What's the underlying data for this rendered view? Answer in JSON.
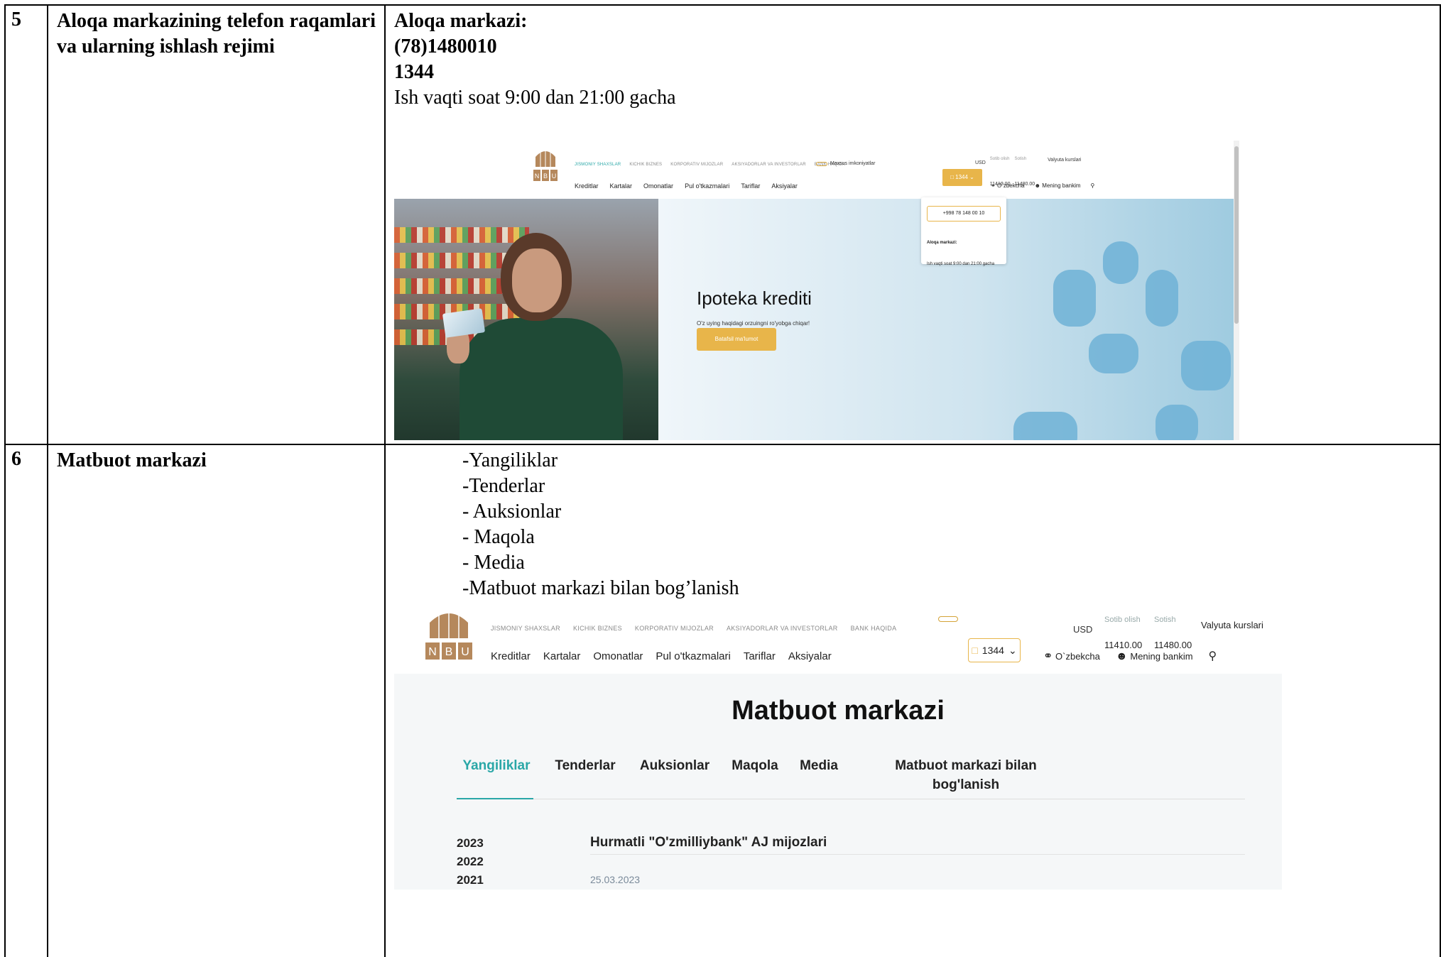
{
  "rows": [
    {
      "number": "5",
      "title": "Aloqa markazining telefon raqamlari va ularning ishlash rejimi",
      "content": {
        "line1": "Aloqa markazi:",
        "line2": "(78)1480010",
        "line3": "1344",
        "line4": "Ish vaqti soat 9:00 dan 21:00 gacha"
      }
    },
    {
      "number": "6",
      "title": "Matbuot markazi",
      "list": [
        "-Yangiliklar",
        "-Tenderlar",
        "- Auksionlar",
        "- Maqola",
        "- Media",
        "-Matbuot markazi bilan bog’lanish"
      ]
    }
  ],
  "screenshot1": {
    "logo_letters": [
      "N",
      "B",
      "U"
    ],
    "top_menu": [
      "JISMONIY SHAXSLAR",
      "KICHIK BIZNES",
      "KORPORATIV MIJOZLAR",
      "AKSIYADORLAR VA INVESTORLAR",
      "BANK HAQIDA"
    ],
    "accessibility": "Maxsus imkoniyatlar",
    "currency": "USD",
    "buy_label": "Sotib olish",
    "buy_value": "11410.00",
    "sell_label": "Sotish",
    "sell_value": "11480.00",
    "rates_link": "Valyuta kurslari",
    "nav": [
      "Kreditlar",
      "Kartalar",
      "Omonatlar",
      "Pul o'tkazmalari",
      "Tariflar",
      "Aksiyalar"
    ],
    "phone_button": "1344",
    "language": "O`zbekcha",
    "my_bank": "Mening bankim",
    "dropdown_phone": "+998 78 148 00 10",
    "dropdown_title": "Aloqa markazi:",
    "dropdown_hours": "Ish vaqti soat 9:00 dan 21:00 gacha",
    "banner_title": "Ipoteka krediti",
    "banner_subtitle": "O'z uying haqidagi orzuingni ro'yobga chiqar!",
    "banner_button": "Batafsil ma'lumot",
    "colors": {
      "accent": "#e8b54a",
      "teal": "#2aa7a7",
      "banner": "#9fcbe0"
    }
  },
  "screenshot2": {
    "logo_letters": [
      "N",
      "B",
      "U"
    ],
    "top_menu": [
      "JISMONIY SHAXSLAR",
      "KICHIK BIZNES",
      "KORPORATIV MIJOZLAR",
      "AKSIYADORLAR VA INVESTORLAR",
      "BANK HAQIDA"
    ],
    "currency": "USD",
    "buy_label": "Sotib olish",
    "buy_value": "11410.00",
    "sell_label": "Sotish",
    "sell_value": "11480.00",
    "rates_link": "Valyuta kurslari",
    "nav": [
      "Kreditlar",
      "Kartalar",
      "Omonatlar",
      "Pul o'tkazmalari",
      "Tariflar",
      "Aksiyalar"
    ],
    "phone_button": "1344",
    "language": "O`zbekcha",
    "my_bank": "Mening bankim",
    "page_title": "Matbuot markazi",
    "tabs": [
      "Yangiliklar",
      "Tenderlar",
      "Auksionlar",
      "Maqola",
      "Media",
      "Matbuot markazi bilan bog'lanish"
    ],
    "years": [
      "2023",
      "2022",
      "2021"
    ],
    "news_title": "Hurmatli \"O'zmilliybank\" AJ mijozlari",
    "news_date": "25.03.2023",
    "colors": {
      "accent": "#e8b54a",
      "teal": "#2aa7a7",
      "panel": "#f5f7f8"
    }
  }
}
